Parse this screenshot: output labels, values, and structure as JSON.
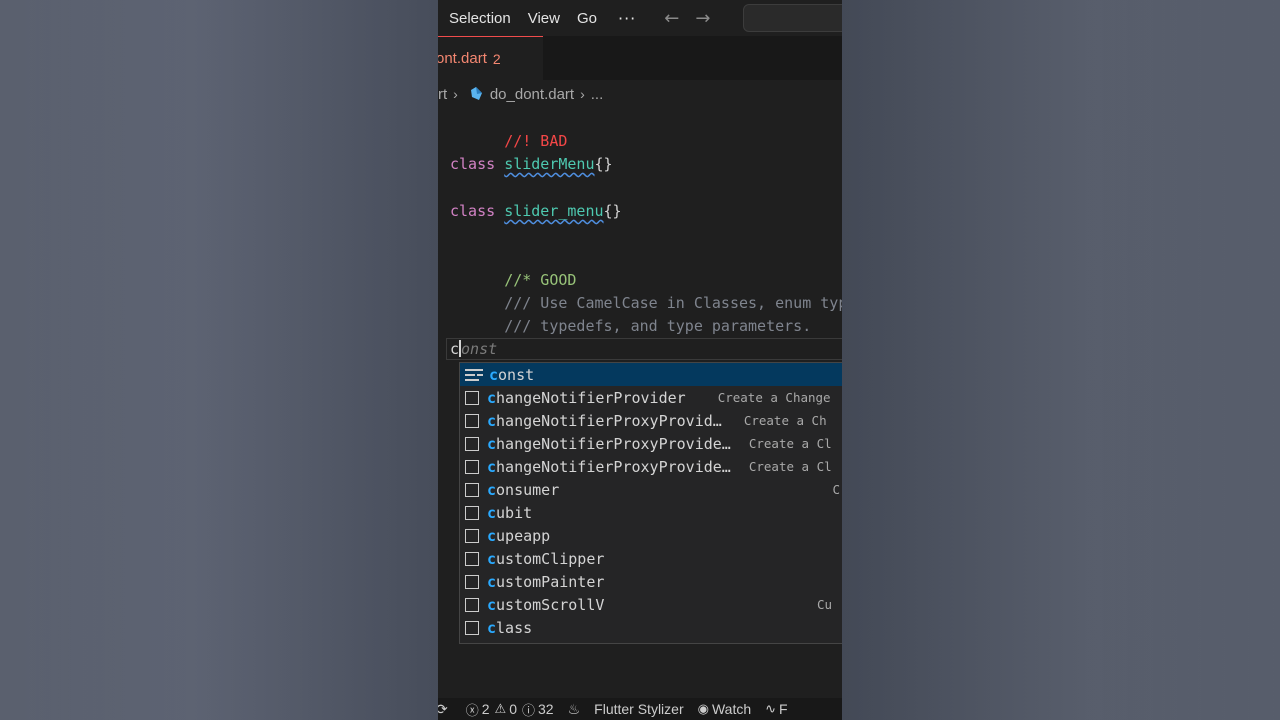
{
  "menubar": {
    "items": [
      "Selection",
      "View",
      "Go"
    ],
    "more": "···",
    "back": "←",
    "forward": "→"
  },
  "tab": {
    "name": "ont.dart",
    "problem_count": "2"
  },
  "breadcrumb": {
    "folder": "rt",
    "file": "do_dont.dart",
    "more": "..."
  },
  "code": {
    "bad_comment": "//! BAD",
    "kw_class": "class",
    "class1": "sliderMenu",
    "class2": "slider_menu",
    "braces": "{}",
    "good_comment": "//* GOOD",
    "doc1": "/// Use CamelCase in Classes, enum types,",
    "doc2": "/// typedefs, and type parameters.",
    "typed": "c",
    "ghost": "onst"
  },
  "suggestions": [
    {
      "match": "c",
      "rest": "onst",
      "detail": "",
      "kind": "keyword"
    },
    {
      "match": "c",
      "rest": "hangeNotifierProvider",
      "detail": "Create a Change",
      "kind": "snippet"
    },
    {
      "match": "c",
      "rest": "hangeNotifierProxyProvid…",
      "detail": "Create a Ch",
      "kind": "snippet"
    },
    {
      "match": "c",
      "rest": "hangeNotifierProxyProvide…",
      "detail": "Create a Cl",
      "kind": "snippet"
    },
    {
      "match": "c",
      "rest": "hangeNotifierProxyProvide…",
      "detail": "Create a Cl",
      "kind": "snippet"
    },
    {
      "match": "c",
      "rest": "onsumer",
      "detail": "C",
      "kind": "snippet"
    },
    {
      "match": "c",
      "rest": "ubit",
      "detail": "",
      "kind": "snippet"
    },
    {
      "match": "c",
      "rest": "upeapp",
      "detail": "",
      "kind": "snippet"
    },
    {
      "match": "c",
      "rest": "ustomClipper",
      "detail": "",
      "kind": "snippet"
    },
    {
      "match": "c",
      "rest": "ustomPainter",
      "detail": "",
      "kind": "snippet"
    },
    {
      "match": "c",
      "rest": "ustomScrollV",
      "detail": "Cu",
      "kind": "snippet"
    },
    {
      "match": "c",
      "rest": "lass",
      "detail": "",
      "kind": "snippet"
    }
  ],
  "statusbar": {
    "errors": "2",
    "warnings": "0",
    "infos": "32",
    "flutter_stylizer": "Flutter Stylizer",
    "watch": "Watch",
    "tail": "F"
  },
  "colors": {
    "error": "#f44747",
    "match_highlight": "#2aaaff",
    "keyword": "#c586c0",
    "type": "#4ec9b0",
    "comment_good": "#98c379"
  }
}
